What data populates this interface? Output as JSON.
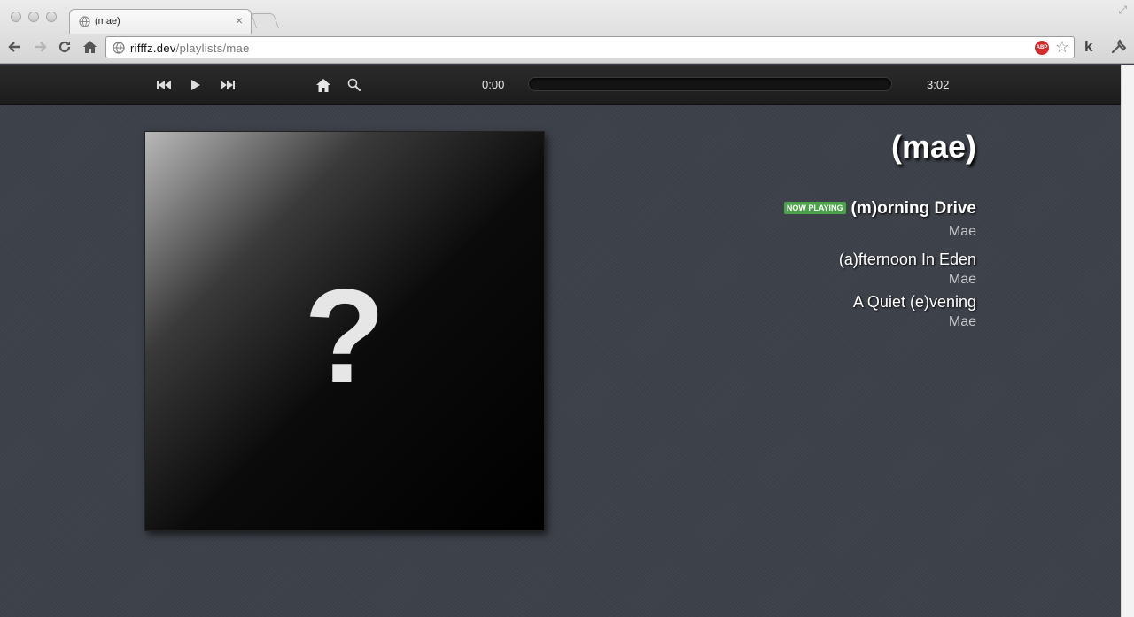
{
  "browser": {
    "tab_title": "(mae)",
    "url_host": "rifffz.dev",
    "url_path": "/playlists/mae",
    "extension_label": "k",
    "adblock_label": "ABP"
  },
  "player": {
    "elapsed": "0:00",
    "duration": "3:02",
    "progress_fraction": 0
  },
  "playlist": {
    "title": "(mae)",
    "now_playing_badge": "NOW PLAYING",
    "tracks": [
      {
        "title": "(m)orning Drive",
        "artist": "Mae",
        "playing": true
      },
      {
        "title": "(a)fternoon In Eden",
        "artist": "Mae",
        "playing": false
      },
      {
        "title": "A Quiet (e)vening",
        "artist": "Mae",
        "playing": false
      }
    ]
  },
  "album_art": {
    "placeholder_glyph": "?"
  },
  "colors": {
    "badge_green": "#4aa34a",
    "background": "#3d414a",
    "player_bar": "#222222"
  }
}
